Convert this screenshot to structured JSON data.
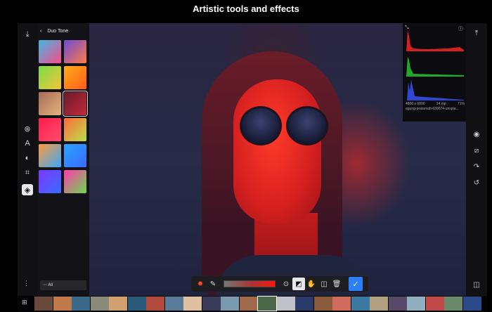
{
  "header": {
    "title": "Artistic tools and effects"
  },
  "panel": {
    "title": "Duo Tone",
    "footer_label": "All",
    "presets": [
      [
        "#3fb8e0",
        "#ff4a8a"
      ],
      [
        "#6e4bd8",
        "#ff7a45"
      ],
      [
        "#7adf4a",
        "#f5c23a"
      ],
      [
        "#ffae1a",
        "#ff5a1a"
      ],
      [
        "#a86a5a",
        "#e3b57a"
      ],
      [
        "#6a1c2c",
        "#c2283c"
      ],
      [
        "#ff1f4f",
        "#ff4a6a"
      ],
      [
        "#ff6a3a",
        "#b8e04a"
      ],
      [
        "#ff9a3a",
        "#3aa8ff"
      ],
      [
        "#2aa4ff",
        "#3a6aff"
      ],
      [
        "#7a3aff",
        "#3a6aff"
      ],
      [
        "#ff3ab0",
        "#6ad84a"
      ]
    ],
    "selected_index": 5
  },
  "histogram": {
    "dimensions": "4800 x 6000",
    "megapixels": "24 mp",
    "zoom": "71%",
    "filename": "agung-pratamah-639674-unspla..."
  },
  "toolbar": {
    "confirm": "✓"
  },
  "icons": {
    "left": [
      "download-icon",
      "effects-icon",
      "text-icon",
      "retouch-icon",
      "crop-icon",
      "layers-icon"
    ],
    "right": [
      "share-icon",
      "camera-icon",
      "strikethrough-icon",
      "redo-icon",
      "undo-icon",
      "compare-icon"
    ]
  },
  "colors": {
    "accent": "#2d7ff9",
    "bg": "#000000"
  }
}
